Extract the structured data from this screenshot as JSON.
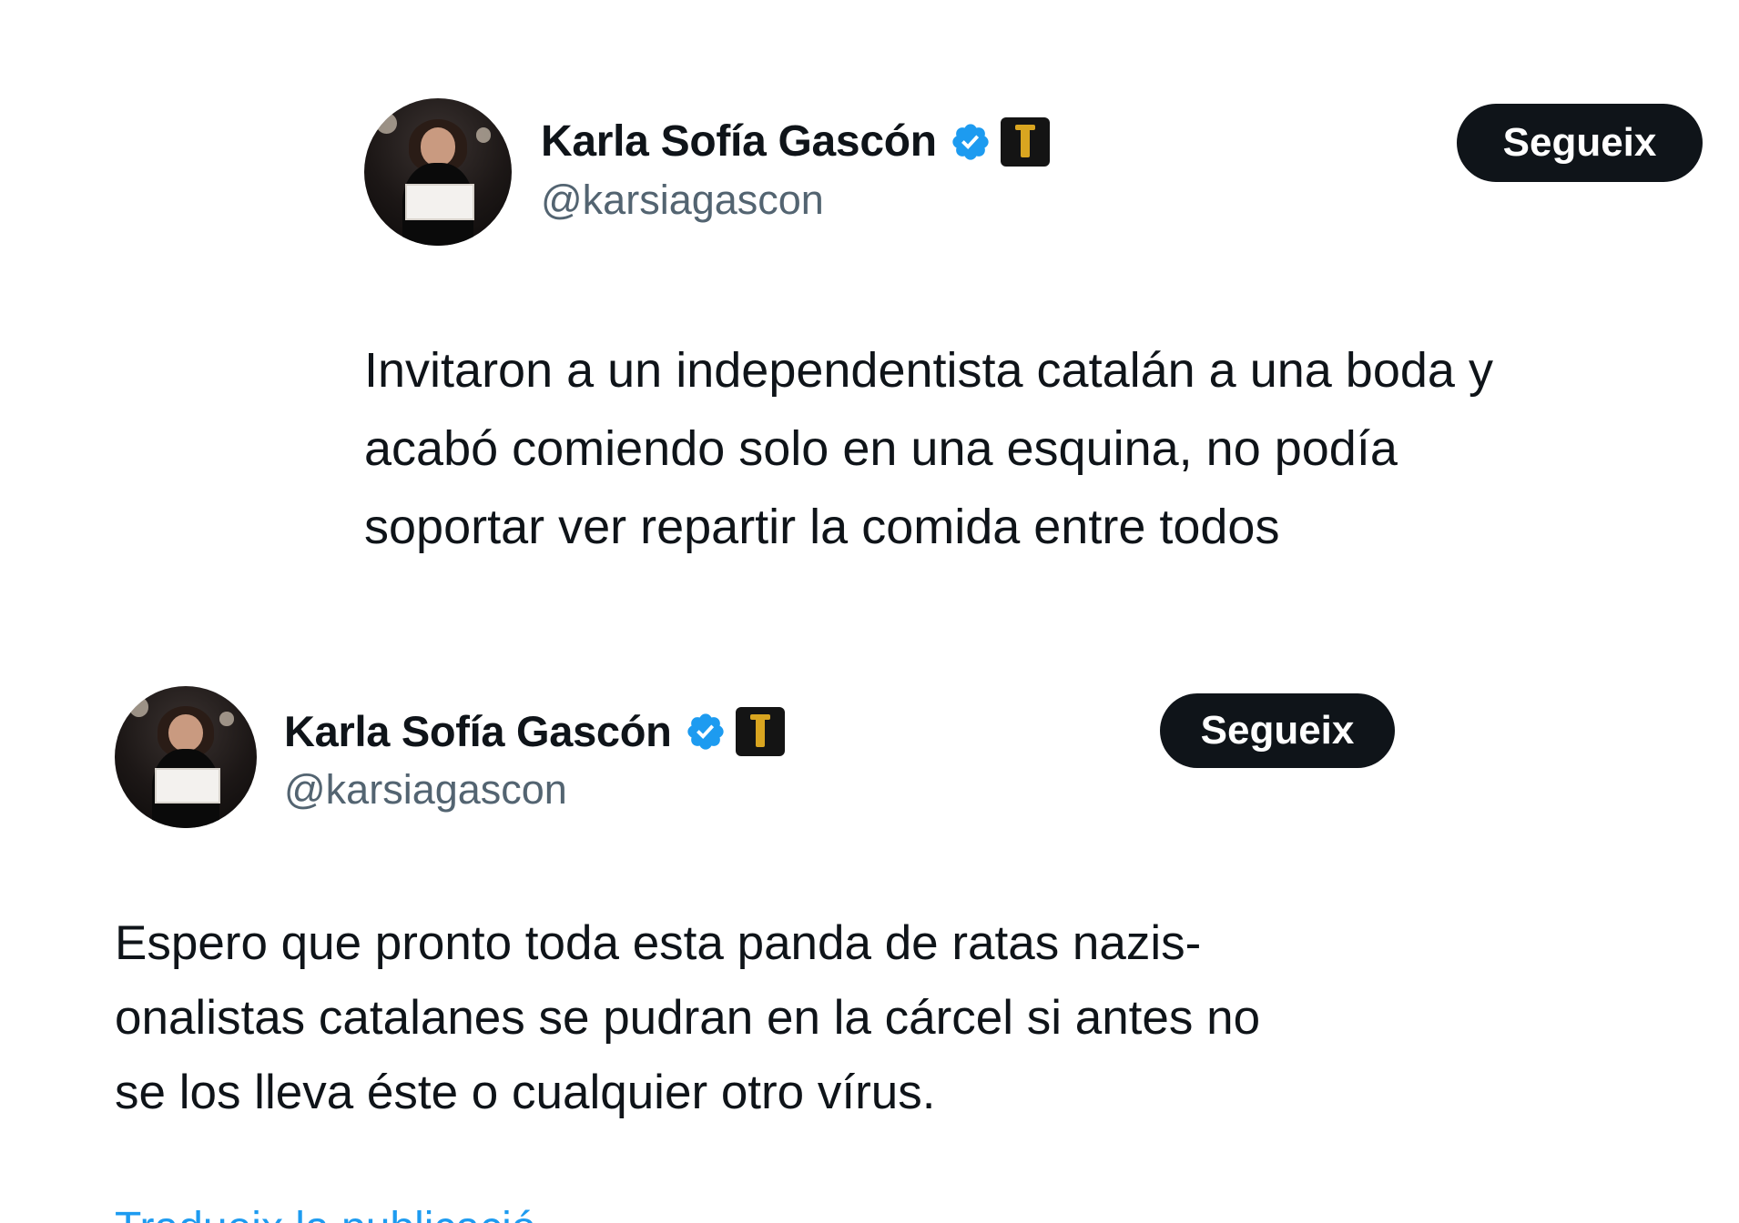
{
  "tweets": [
    {
      "author": {
        "display_name": "Karla Sofía Gascón",
        "handle": "@karsiagascon",
        "avatar_icon": "profile-photo",
        "verified_icon": "verified-badge-icon",
        "verified_color": "#1d9bf0",
        "affiliate_icon": "affiliate-badge-icon"
      },
      "follow_label": "Segueix",
      "text_lines": [
        "Invitaron a un independentista catalán a una boda y",
        "acabó comiendo solo en una esquina, no podía",
        "soportar ver repartir la comida entre todos"
      ]
    },
    {
      "author": {
        "display_name": "Karla Sofía Gascón",
        "handle": "@karsiagascon",
        "avatar_icon": "profile-photo",
        "verified_icon": "verified-badge-icon",
        "verified_color": "#1d9bf0",
        "affiliate_icon": "affiliate-badge-icon"
      },
      "follow_label": "Segueix",
      "text_lines": [
        "Espero que pronto toda esta panda de ratas nazis-",
        "onalistas catalanes se pudran en la cárcel si antes no",
        "se los lleva éste o cualquier otro vírus."
      ],
      "translate_link": "Tradueix la publicació"
    }
  ],
  "colors": {
    "text": "#0f1419",
    "secondary_text": "#536471",
    "link": "#1d9bf0",
    "button_bg": "#0f1419",
    "button_text": "#ffffff"
  }
}
